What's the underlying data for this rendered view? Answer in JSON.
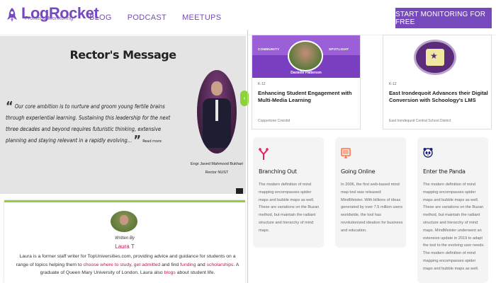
{
  "header": {
    "logo_word": "LogRocket",
    "logo_sub": "Frontend Monitoring",
    "nav": [
      "BLOG",
      "PODCAST",
      "MEETUPS"
    ],
    "cta": "START MONITORING FOR FREE",
    "accent": "#764abc"
  },
  "rector": {
    "title": "Rector's Message",
    "quote": "Our core ambition is to nurture and groom young fertile brains through experiential learning. Sustaining this leadership for the next three decades and beyond requires futuristic thinking, extensive planning and staying relevant in a rapidly evolving...",
    "read_more": "Read more",
    "name": "Engr Javed Mahmood Bukhari",
    "role": "Rector NUST",
    "toggle_icon": "‹"
  },
  "author": {
    "written_by": "Written By",
    "name": "Laura T",
    "bio_1": "Laura is a former staff writer for TopUniversities.com, providing advice and guidance for students on a range of topics helping them to ",
    "bio_link_1": "choose where to study",
    "bio_2": ", ",
    "bio_link_2": "get admitted",
    "bio_3": " and find ",
    "bio_link_3": "funding",
    "bio_4": " and ",
    "bio_link_4": "scholarships",
    "bio_5": ". A graduate of Queen Mary University of London, Laura also ",
    "bio_link_5": "blogs",
    "bio_6": " about student life."
  },
  "cards": [
    {
      "img_left": "COMMUNITY",
      "img_right": "SPOTLIGHT",
      "img_caption": "Danielle Patterson",
      "tag": "K-12",
      "title": "Enhancing Student Engagement with Multi-Media Learning",
      "footer": "Coppertone Covictid"
    },
    {
      "tag": "K-12",
      "title": "East Irondequoit Advances their Digital Conversion with Schoology's LMS",
      "footer": "East Irondequoit Central School District"
    }
  ],
  "features": [
    {
      "icon": "branch-icon",
      "title": "Branching Out",
      "body": "The modern definition of mind mapping encompasses spider maps and bubble maps as well. These are variations on the Buzan method, but maintain the radiant structure and hierarchy of mind maps."
    },
    {
      "icon": "monitor-icon",
      "title": "Going Online",
      "body": "In 2006, the first web-based mind map tool was released: MindMeister. With billions of ideas generated by over 7.5 million users worldwide, the tool has revolutionized ideation for business and education."
    },
    {
      "icon": "panda-icon",
      "title": "Enter the Panda",
      "body": "The modern definition of mind mapping encompasses spider maps and bubble maps as well. These are variations on the Buzan method, but maintain the radiant structure and hierarchy of mind maps. MindMeister underwent an extensive update in 2019 to adapt the tool to the evolving user needs. The modern definition of mind mapping encompasses spider maps and bubble maps as well."
    }
  ]
}
